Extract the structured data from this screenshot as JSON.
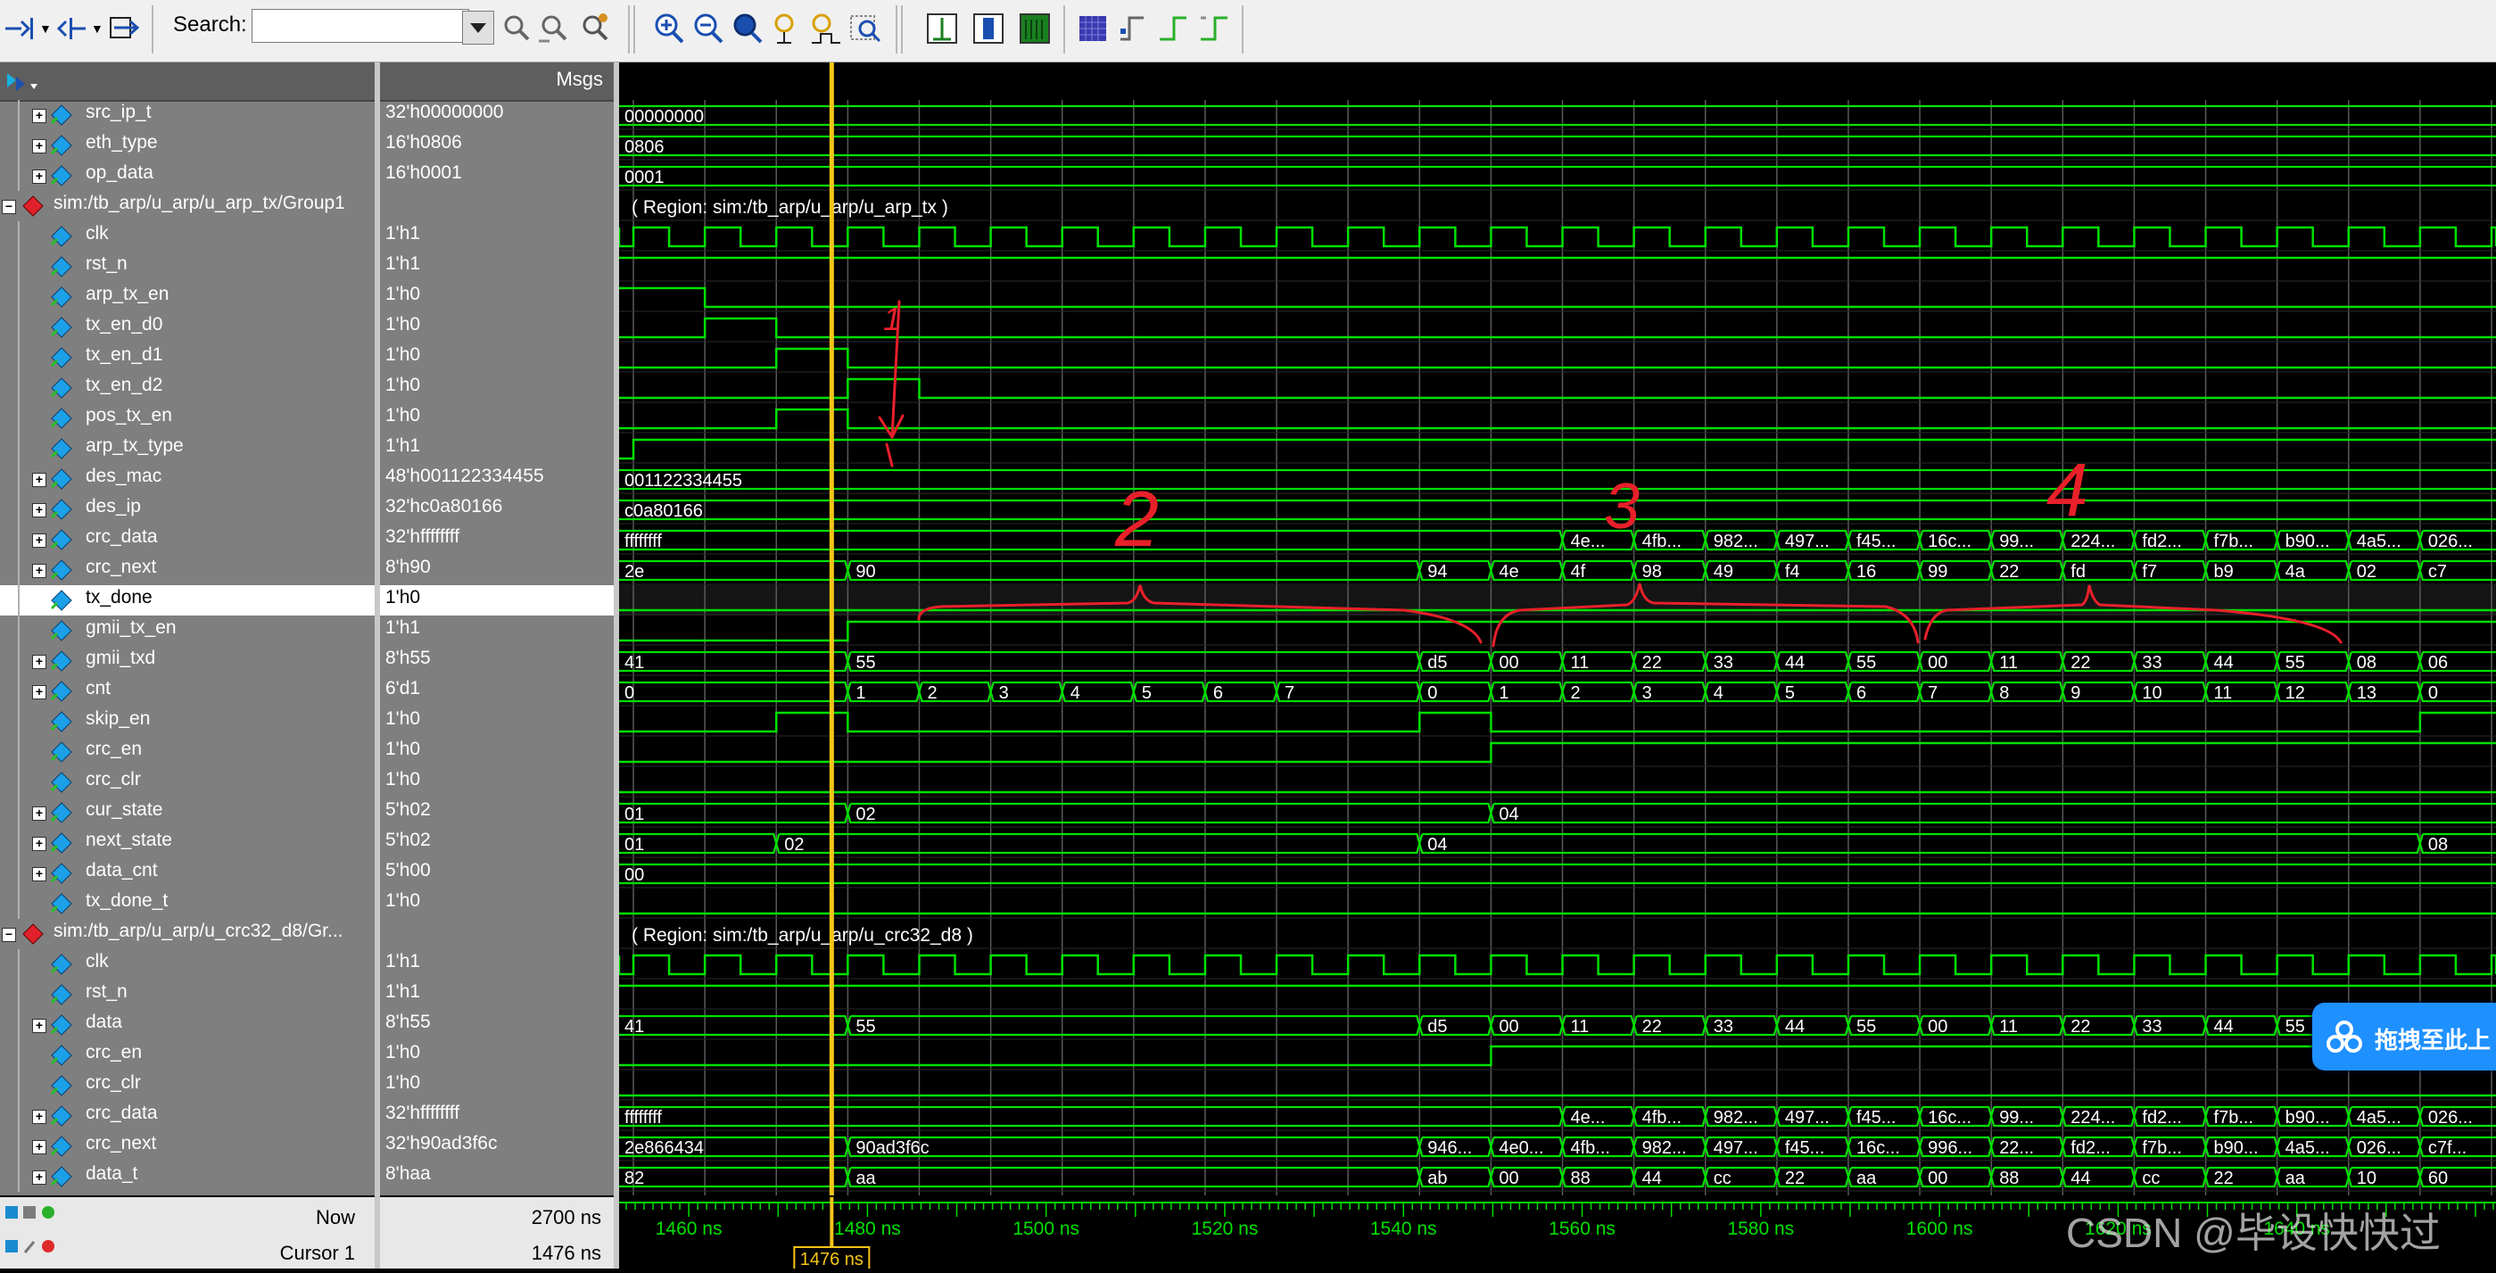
{
  "toolbar": {
    "search_label": "Search:",
    "search_value": "",
    "search_placeholder": ""
  },
  "panes": {
    "msgs_header": "Msgs"
  },
  "signals": [
    {
      "name": "src_ip_t",
      "value": "32'h00000000",
      "indent": 1,
      "expand": true,
      "kind": "bus"
    },
    {
      "name": "eth_type",
      "value": "16'h0806",
      "indent": 1,
      "expand": true,
      "kind": "bus"
    },
    {
      "name": "op_data",
      "value": "16'h0001",
      "indent": 1,
      "expand": true,
      "kind": "bus"
    },
    {
      "name": "sim:/tb_arp/u_arp/u_arp_tx/Group1",
      "value": "",
      "indent": 0,
      "expand": true,
      "kind": "group"
    },
    {
      "name": "clk",
      "value": "1'h1",
      "indent": 1,
      "expand": false,
      "kind": "bit"
    },
    {
      "name": "rst_n",
      "value": "1'h1",
      "indent": 1,
      "expand": false,
      "kind": "bit"
    },
    {
      "name": "arp_tx_en",
      "value": "1'h0",
      "indent": 1,
      "expand": false,
      "kind": "bit"
    },
    {
      "name": "tx_en_d0",
      "value": "1'h0",
      "indent": 1,
      "expand": false,
      "kind": "bit"
    },
    {
      "name": "tx_en_d1",
      "value": "1'h0",
      "indent": 1,
      "expand": false,
      "kind": "bit"
    },
    {
      "name": "tx_en_d2",
      "value": "1'h0",
      "indent": 1,
      "expand": false,
      "kind": "bit"
    },
    {
      "name": "pos_tx_en",
      "value": "1'h0",
      "indent": 1,
      "expand": false,
      "kind": "bit"
    },
    {
      "name": "arp_tx_type",
      "value": "1'h1",
      "indent": 1,
      "expand": false,
      "kind": "bit"
    },
    {
      "name": "des_mac",
      "value": "48'h001122334455",
      "indent": 1,
      "expand": true,
      "kind": "bus"
    },
    {
      "name": "des_ip",
      "value": "32'hc0a80166",
      "indent": 1,
      "expand": true,
      "kind": "bus"
    },
    {
      "name": "crc_data",
      "value": "32'hffffffff",
      "indent": 1,
      "expand": true,
      "kind": "bus"
    },
    {
      "name": "crc_next",
      "value": "8'h90",
      "indent": 1,
      "expand": true,
      "kind": "bus"
    },
    {
      "name": "tx_done",
      "value": "1'h0",
      "indent": 1,
      "expand": false,
      "kind": "bit",
      "selected": true
    },
    {
      "name": "gmii_tx_en",
      "value": "1'h1",
      "indent": 1,
      "expand": false,
      "kind": "bit"
    },
    {
      "name": "gmii_txd",
      "value": "8'h55",
      "indent": 1,
      "expand": true,
      "kind": "bus"
    },
    {
      "name": "cnt",
      "value": "6'd1",
      "indent": 1,
      "expand": true,
      "kind": "bus"
    },
    {
      "name": "skip_en",
      "value": "1'h0",
      "indent": 1,
      "expand": false,
      "kind": "bit"
    },
    {
      "name": "crc_en",
      "value": "1'h0",
      "indent": 1,
      "expand": false,
      "kind": "bit"
    },
    {
      "name": "crc_clr",
      "value": "1'h0",
      "indent": 1,
      "expand": false,
      "kind": "bit"
    },
    {
      "name": "cur_state",
      "value": "5'h02",
      "indent": 1,
      "expand": true,
      "kind": "bus"
    },
    {
      "name": "next_state",
      "value": "5'h02",
      "indent": 1,
      "expand": true,
      "kind": "bus"
    },
    {
      "name": "data_cnt",
      "value": "5'h00",
      "indent": 1,
      "expand": true,
      "kind": "bus"
    },
    {
      "name": "tx_done_t",
      "value": "1'h0",
      "indent": 1,
      "expand": false,
      "kind": "bit"
    },
    {
      "name": "sim:/tb_arp/u_arp/u_crc32_d8/Gr...",
      "value": "",
      "indent": 0,
      "expand": true,
      "kind": "group"
    },
    {
      "name": "clk",
      "value": "1'h1",
      "indent": 1,
      "expand": false,
      "kind": "bit"
    },
    {
      "name": "rst_n",
      "value": "1'h1",
      "indent": 1,
      "expand": false,
      "kind": "bit"
    },
    {
      "name": "data",
      "value": "8'h55",
      "indent": 1,
      "expand": true,
      "kind": "bus"
    },
    {
      "name": "crc_en",
      "value": "1'h0",
      "indent": 1,
      "expand": false,
      "kind": "bit"
    },
    {
      "name": "crc_clr",
      "value": "1'h0",
      "indent": 1,
      "expand": false,
      "kind": "bit"
    },
    {
      "name": "crc_data",
      "value": "32'hffffffff",
      "indent": 1,
      "expand": true,
      "kind": "bus"
    },
    {
      "name": "crc_next",
      "value": "32'h90ad3f6c",
      "indent": 1,
      "expand": true,
      "kind": "bus"
    },
    {
      "name": "data_t",
      "value": "8'haa",
      "indent": 1,
      "expand": true,
      "kind": "bus"
    }
  ],
  "bottom": {
    "now_label": "Now",
    "now_value": "2700 ns",
    "cursor_label": "Cursor 1",
    "cursor_value": "1476 ns",
    "cursor_flag": "1476 ns"
  },
  "timeline": {
    "t_start": 1452.2,
    "t_end": 1662.3,
    "cursor_time": 1476,
    "major_ticks": [
      {
        "t": 1460,
        "label": "1460 ns"
      },
      {
        "t": 1480,
        "label": "1480 ns"
      },
      {
        "t": 1500,
        "label": "1500 ns"
      },
      {
        "t": 1520,
        "label": "1520 ns"
      },
      {
        "t": 1540,
        "label": "1540 ns"
      },
      {
        "t": 1560,
        "label": "1560 ns"
      },
      {
        "t": 1580,
        "label": "1580 ns"
      },
      {
        "t": 1600,
        "label": "1600 ns"
      },
      {
        "t": 1620,
        "label": "1620 ns"
      },
      {
        "t": 1640,
        "label": "1640 ns"
      }
    ],
    "clk_period": 8,
    "clk_first_rise": 1453.8
  },
  "waves": {
    "0": {
      "type": "bus",
      "segs": [
        {
          "t": 1452.2,
          "v": "00000000"
        }
      ]
    },
    "1": {
      "type": "bus",
      "segs": [
        {
          "t": 1452.2,
          "v": "0806"
        }
      ]
    },
    "2": {
      "type": "bus",
      "segs": [
        {
          "t": 1452.2,
          "v": "0001"
        }
      ]
    },
    "3": {
      "type": "region",
      "text": "( Region: sim:/tb_arp/u_arp/u_arp_tx )"
    },
    "4": {
      "type": "clk"
    },
    "5": {
      "type": "bit",
      "init": 1,
      "edges": []
    },
    "6": {
      "type": "bit",
      "init": 1,
      "edges": [
        1461.8
      ]
    },
    "7": {
      "type": "bit",
      "init": 0,
      "edges": [
        1461.8,
        1469.8
      ]
    },
    "8": {
      "type": "bit",
      "init": 0,
      "edges": [
        1469.8,
        1477.8
      ]
    },
    "9": {
      "type": "bit",
      "init": 0,
      "edges": [
        1477.8,
        1485.8
      ]
    },
    "10": {
      "type": "bit",
      "init": 0,
      "edges": [
        1469.8,
        1477.8
      ]
    },
    "11": {
      "type": "bit",
      "init": 0,
      "edges": [
        1453.8
      ]
    },
    "12": {
      "type": "bus",
      "segs": [
        {
          "t": 1452.2,
          "v": "001122334455"
        }
      ]
    },
    "13": {
      "type": "bus",
      "segs": [
        {
          "t": 1452.2,
          "v": "c0a80166"
        }
      ]
    },
    "14": {
      "type": "bus",
      "segs": [
        {
          "t": 1452.2,
          "v": "ffffffff"
        },
        {
          "t": 1557.8,
          "v": "4e..."
        },
        {
          "t": 1565.8,
          "v": "4fb..."
        },
        {
          "t": 1573.8,
          "v": "982..."
        },
        {
          "t": 1581.8,
          "v": "497..."
        },
        {
          "t": 1589.8,
          "v": "f45..."
        },
        {
          "t": 1597.8,
          "v": "16c..."
        },
        {
          "t": 1605.8,
          "v": "99..."
        },
        {
          "t": 1613.8,
          "v": "224..."
        },
        {
          "t": 1621.8,
          "v": "fd2..."
        },
        {
          "t": 1629.8,
          "v": "f7b..."
        },
        {
          "t": 1637.8,
          "v": "b90..."
        },
        {
          "t": 1645.8,
          "v": "4a5..."
        },
        {
          "t": 1653.8,
          "v": "026..."
        }
      ]
    },
    "15": {
      "type": "bus",
      "segs": [
        {
          "t": 1452.2,
          "v": "2e"
        },
        {
          "t": 1477.8,
          "v": "90"
        },
        {
          "t": 1541.8,
          "v": "94"
        },
        {
          "t": 1549.8,
          "v": "4e"
        },
        {
          "t": 1557.8,
          "v": "4f"
        },
        {
          "t": 1565.8,
          "v": "98"
        },
        {
          "t": 1573.8,
          "v": "49"
        },
        {
          "t": 1581.8,
          "v": "f4"
        },
        {
          "t": 1589.8,
          "v": "16"
        },
        {
          "t": 1597.8,
          "v": "99"
        },
        {
          "t": 1605.8,
          "v": "22"
        },
        {
          "t": 1613.8,
          "v": "fd"
        },
        {
          "t": 1621.8,
          "v": "f7"
        },
        {
          "t": 1629.8,
          "v": "b9"
        },
        {
          "t": 1637.8,
          "v": "4a"
        },
        {
          "t": 1645.8,
          "v": "02"
        },
        {
          "t": 1653.8,
          "v": "c7"
        }
      ]
    },
    "16": {
      "type": "bit",
      "init": 0,
      "edges": []
    },
    "17": {
      "type": "bit",
      "init": 0,
      "edges": [
        1477.8
      ]
    },
    "18": {
      "type": "bus",
      "segs": [
        {
          "t": 1452.2,
          "v": "41"
        },
        {
          "t": 1477.8,
          "v": "55"
        },
        {
          "t": 1541.8,
          "v": "d5"
        },
        {
          "t": 1549.8,
          "v": "00"
        },
        {
          "t": 1557.8,
          "v": "11"
        },
        {
          "t": 1565.8,
          "v": "22"
        },
        {
          "t": 1573.8,
          "v": "33"
        },
        {
          "t": 1581.8,
          "v": "44"
        },
        {
          "t": 1589.8,
          "v": "55"
        },
        {
          "t": 1597.8,
          "v": "00"
        },
        {
          "t": 1605.8,
          "v": "11"
        },
        {
          "t": 1613.8,
          "v": "22"
        },
        {
          "t": 1621.8,
          "v": "33"
        },
        {
          "t": 1629.8,
          "v": "44"
        },
        {
          "t": 1637.8,
          "v": "55"
        },
        {
          "t": 1645.8,
          "v": "08"
        },
        {
          "t": 1653.8,
          "v": "06"
        }
      ]
    },
    "19": {
      "type": "bus",
      "segs": [
        {
          "t": 1452.2,
          "v": "0"
        },
        {
          "t": 1477.8,
          "v": "1"
        },
        {
          "t": 1485.8,
          "v": "2"
        },
        {
          "t": 1493.8,
          "v": "3"
        },
        {
          "t": 1501.8,
          "v": "4"
        },
        {
          "t": 1509.8,
          "v": "5"
        },
        {
          "t": 1517.8,
          "v": "6"
        },
        {
          "t": 1525.8,
          "v": "7"
        },
        {
          "t": 1541.8,
          "v": "0"
        },
        {
          "t": 1549.8,
          "v": "1"
        },
        {
          "t": 1557.8,
          "v": "2"
        },
        {
          "t": 1565.8,
          "v": "3"
        },
        {
          "t": 1573.8,
          "v": "4"
        },
        {
          "t": 1581.8,
          "v": "5"
        },
        {
          "t": 1589.8,
          "v": "6"
        },
        {
          "t": 1597.8,
          "v": "7"
        },
        {
          "t": 1605.8,
          "v": "8"
        },
        {
          "t": 1613.8,
          "v": "9"
        },
        {
          "t": 1621.8,
          "v": "10"
        },
        {
          "t": 1629.8,
          "v": "11"
        },
        {
          "t": 1637.8,
          "v": "12"
        },
        {
          "t": 1645.8,
          "v": "13"
        },
        {
          "t": 1653.8,
          "v": "0"
        }
      ]
    },
    "20": {
      "type": "bit",
      "init": 0,
      "edges": [
        1469.8,
        1477.8,
        1541.8,
        1549.8,
        1653.8
      ]
    },
    "21": {
      "type": "bit",
      "init": 0,
      "edges": [
        1549.8
      ]
    },
    "22": {
      "type": "bit",
      "init": 0,
      "edges": []
    },
    "23": {
      "type": "bus",
      "segs": [
        {
          "t": 1452.2,
          "v": "01"
        },
        {
          "t": 1477.8,
          "v": "02"
        },
        {
          "t": 1549.8,
          "v": "04"
        }
      ]
    },
    "24": {
      "type": "bus",
      "segs": [
        {
          "t": 1452.2,
          "v": "01"
        },
        {
          "t": 1469.8,
          "v": "02"
        },
        {
          "t": 1541.8,
          "v": "04"
        },
        {
          "t": 1653.8,
          "v": "08"
        }
      ]
    },
    "25": {
      "type": "bus",
      "segs": [
        {
          "t": 1452.2,
          "v": "00"
        }
      ]
    },
    "26": {
      "type": "bit",
      "init": 0,
      "edges": []
    },
    "27": {
      "type": "region",
      "text": "( Region: sim:/tb_arp/u_arp/u_crc32_d8 )"
    },
    "28": {
      "type": "clk"
    },
    "29": {
      "type": "bit",
      "init": 1,
      "edges": []
    },
    "30": {
      "type": "bus",
      "segs": [
        {
          "t": 1452.2,
          "v": "41"
        },
        {
          "t": 1477.8,
          "v": "55"
        },
        {
          "t": 1541.8,
          "v": "d5"
        },
        {
          "t": 1549.8,
          "v": "00"
        },
        {
          "t": 1557.8,
          "v": "11"
        },
        {
          "t": 1565.8,
          "v": "22"
        },
        {
          "t": 1573.8,
          "v": "33"
        },
        {
          "t": 1581.8,
          "v": "44"
        },
        {
          "t": 1589.8,
          "v": "55"
        },
        {
          "t": 1597.8,
          "v": "00"
        },
        {
          "t": 1605.8,
          "v": "11"
        },
        {
          "t": 1613.8,
          "v": "22"
        },
        {
          "t": 1621.8,
          "v": "33"
        },
        {
          "t": 1629.8,
          "v": "44"
        },
        {
          "t": 1637.8,
          "v": "55"
        }
      ]
    },
    "31": {
      "type": "bit",
      "init": 0,
      "edges": [
        1549.8
      ]
    },
    "32": {
      "type": "bit",
      "init": 0,
      "edges": []
    },
    "33": {
      "type": "bus",
      "segs": [
        {
          "t": 1452.2,
          "v": "ffffffff"
        },
        {
          "t": 1557.8,
          "v": "4e..."
        },
        {
          "t": 1565.8,
          "v": "4fb..."
        },
        {
          "t": 1573.8,
          "v": "982..."
        },
        {
          "t": 1581.8,
          "v": "497..."
        },
        {
          "t": 1589.8,
          "v": "f45..."
        },
        {
          "t": 1597.8,
          "v": "16c..."
        },
        {
          "t": 1605.8,
          "v": "99..."
        },
        {
          "t": 1613.8,
          "v": "224..."
        },
        {
          "t": 1621.8,
          "v": "fd2..."
        },
        {
          "t": 1629.8,
          "v": "f7b..."
        },
        {
          "t": 1637.8,
          "v": "b90..."
        },
        {
          "t": 1645.8,
          "v": "4a5..."
        },
        {
          "t": 1653.8,
          "v": "026..."
        }
      ]
    },
    "34": {
      "type": "bus",
      "segs": [
        {
          "t": 1452.2,
          "v": "2e866434"
        },
        {
          "t": 1477.8,
          "v": "90ad3f6c"
        },
        {
          "t": 1541.8,
          "v": "946..."
        },
        {
          "t": 1549.8,
          "v": "4e0..."
        },
        {
          "t": 1557.8,
          "v": "4fb..."
        },
        {
          "t": 1565.8,
          "v": "982..."
        },
        {
          "t": 1573.8,
          "v": "497..."
        },
        {
          "t": 1581.8,
          "v": "f45..."
        },
        {
          "t": 1589.8,
          "v": "16c..."
        },
        {
          "t": 1597.8,
          "v": "996..."
        },
        {
          "t": 1605.8,
          "v": "22..."
        },
        {
          "t": 1613.8,
          "v": "fd2..."
        },
        {
          "t": 1621.8,
          "v": "f7b..."
        },
        {
          "t": 1629.8,
          "v": "b90..."
        },
        {
          "t": 1637.8,
          "v": "4a5..."
        },
        {
          "t": 1645.8,
          "v": "026..."
        },
        {
          "t": 1653.8,
          "v": "c7f..."
        }
      ]
    },
    "35": {
      "type": "bus",
      "segs": [
        {
          "t": 1452.2,
          "v": "82"
        },
        {
          "t": 1477.8,
          "v": "aa"
        },
        {
          "t": 1541.8,
          "v": "ab"
        },
        {
          "t": 1549.8,
          "v": "00"
        },
        {
          "t": 1557.8,
          "v": "88"
        },
        {
          "t": 1565.8,
          "v": "44"
        },
        {
          "t": 1573.8,
          "v": "cc"
        },
        {
          "t": 1581.8,
          "v": "22"
        },
        {
          "t": 1589.8,
          "v": "aa"
        },
        {
          "t": 1597.8,
          "v": "00"
        },
        {
          "t": 1605.8,
          "v": "88"
        },
        {
          "t": 1613.8,
          "v": "44"
        },
        {
          "t": 1621.8,
          "v": "cc"
        },
        {
          "t": 1629.8,
          "v": "22"
        },
        {
          "t": 1637.8,
          "v": "aa"
        },
        {
          "t": 1645.8,
          "v": "10"
        },
        {
          "t": 1653.8,
          "v": "60"
        }
      ]
    }
  },
  "annotations": {
    "numbers": [
      "1",
      "2",
      "3",
      "4"
    ],
    "color": "#e8202a"
  },
  "overlay": {
    "upload_button_text": "拖拽至此上",
    "watermark": "CSDN @毕设快快过"
  },
  "colors": {
    "wave": "#00e000",
    "cursor": "#f5c518",
    "grid": "#5a5a5a",
    "pane_bg": "#7f7f7f"
  }
}
